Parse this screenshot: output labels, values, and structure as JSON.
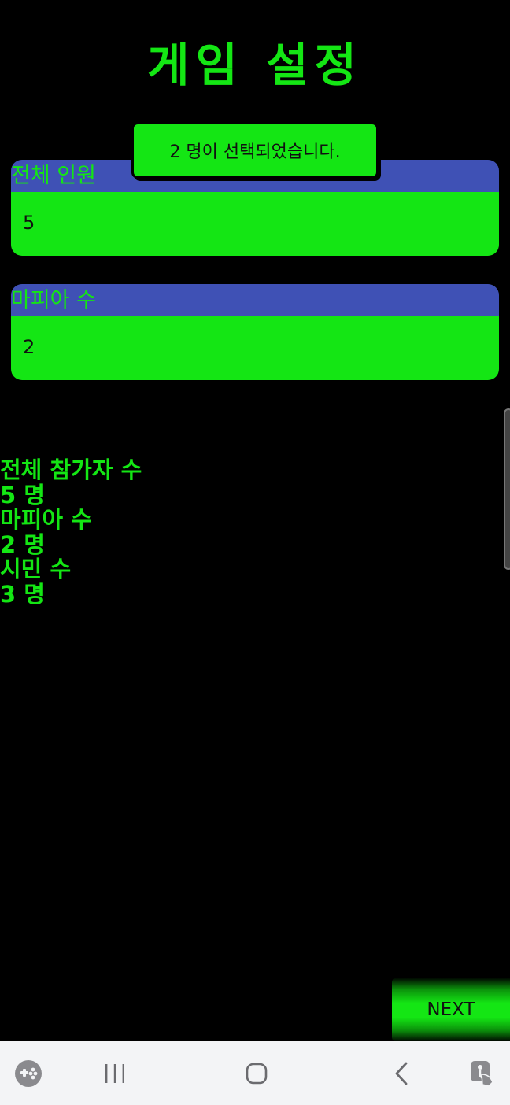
{
  "header": {
    "title": "게임 설정"
  },
  "toast": {
    "message": "2 명이 선택되었습니다."
  },
  "form": {
    "total": {
      "label": "전체 인원",
      "value": "5"
    },
    "mafia": {
      "label": "마피아 수",
      "value": "2"
    }
  },
  "summary": {
    "lines": [
      "전체 참가자 수",
      "5 명",
      "마피아 수",
      "2 명",
      "시민 수",
      "3 명"
    ]
  },
  "next_button": {
    "label": "NEXT"
  },
  "navbar": {
    "icons": [
      "game-launcher-icon",
      "recents-icon",
      "home-icon",
      "back-icon",
      "assistant-icon"
    ]
  },
  "colors": {
    "accent": "#14e614",
    "label_bg": "#3f51b5",
    "background": "#000000",
    "navbar_bg": "#f3f4f6"
  }
}
